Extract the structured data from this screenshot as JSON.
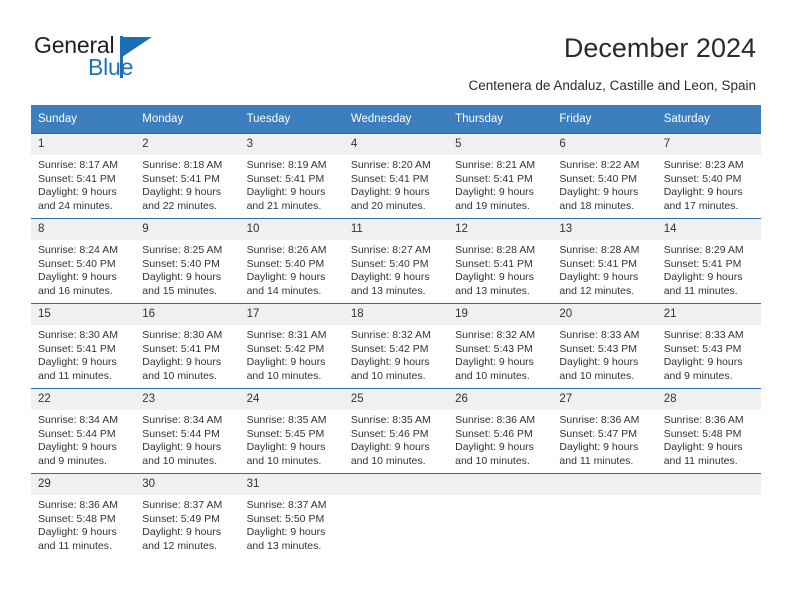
{
  "brand": {
    "name_top": "General",
    "name_bottom": "Blue",
    "accent_color": "#1c75bc"
  },
  "header": {
    "title": "December 2024",
    "subtitle": "Centenera de Andaluz, Castille and Leon, Spain",
    "header_bg_color": "#3d7ebf"
  },
  "calendar": {
    "weekday_headers": [
      "Sunday",
      "Monday",
      "Tuesday",
      "Wednesday",
      "Thursday",
      "Friday",
      "Saturday"
    ],
    "weeks": [
      [
        {
          "day": "1",
          "sunrise": "Sunrise: 8:17 AM",
          "sunset": "Sunset: 5:41 PM",
          "daylight1": "Daylight: 9 hours",
          "daylight2": "and 24 minutes."
        },
        {
          "day": "2",
          "sunrise": "Sunrise: 8:18 AM",
          "sunset": "Sunset: 5:41 PM",
          "daylight1": "Daylight: 9 hours",
          "daylight2": "and 22 minutes."
        },
        {
          "day": "3",
          "sunrise": "Sunrise: 8:19 AM",
          "sunset": "Sunset: 5:41 PM",
          "daylight1": "Daylight: 9 hours",
          "daylight2": "and 21 minutes."
        },
        {
          "day": "4",
          "sunrise": "Sunrise: 8:20 AM",
          "sunset": "Sunset: 5:41 PM",
          "daylight1": "Daylight: 9 hours",
          "daylight2": "and 20 minutes."
        },
        {
          "day": "5",
          "sunrise": "Sunrise: 8:21 AM",
          "sunset": "Sunset: 5:41 PM",
          "daylight1": "Daylight: 9 hours",
          "daylight2": "and 19 minutes."
        },
        {
          "day": "6",
          "sunrise": "Sunrise: 8:22 AM",
          "sunset": "Sunset: 5:40 PM",
          "daylight1": "Daylight: 9 hours",
          "daylight2": "and 18 minutes."
        },
        {
          "day": "7",
          "sunrise": "Sunrise: 8:23 AM",
          "sunset": "Sunset: 5:40 PM",
          "daylight1": "Daylight: 9 hours",
          "daylight2": "and 17 minutes."
        }
      ],
      [
        {
          "day": "8",
          "sunrise": "Sunrise: 8:24 AM",
          "sunset": "Sunset: 5:40 PM",
          "daylight1": "Daylight: 9 hours",
          "daylight2": "and 16 minutes."
        },
        {
          "day": "9",
          "sunrise": "Sunrise: 8:25 AM",
          "sunset": "Sunset: 5:40 PM",
          "daylight1": "Daylight: 9 hours",
          "daylight2": "and 15 minutes."
        },
        {
          "day": "10",
          "sunrise": "Sunrise: 8:26 AM",
          "sunset": "Sunset: 5:40 PM",
          "daylight1": "Daylight: 9 hours",
          "daylight2": "and 14 minutes."
        },
        {
          "day": "11",
          "sunrise": "Sunrise: 8:27 AM",
          "sunset": "Sunset: 5:40 PM",
          "daylight1": "Daylight: 9 hours",
          "daylight2": "and 13 minutes."
        },
        {
          "day": "12",
          "sunrise": "Sunrise: 8:28 AM",
          "sunset": "Sunset: 5:41 PM",
          "daylight1": "Daylight: 9 hours",
          "daylight2": "and 13 minutes."
        },
        {
          "day": "13",
          "sunrise": "Sunrise: 8:28 AM",
          "sunset": "Sunset: 5:41 PM",
          "daylight1": "Daylight: 9 hours",
          "daylight2": "and 12 minutes."
        },
        {
          "day": "14",
          "sunrise": "Sunrise: 8:29 AM",
          "sunset": "Sunset: 5:41 PM",
          "daylight1": "Daylight: 9 hours",
          "daylight2": "and 11 minutes."
        }
      ],
      [
        {
          "day": "15",
          "sunrise": "Sunrise: 8:30 AM",
          "sunset": "Sunset: 5:41 PM",
          "daylight1": "Daylight: 9 hours",
          "daylight2": "and 11 minutes."
        },
        {
          "day": "16",
          "sunrise": "Sunrise: 8:30 AM",
          "sunset": "Sunset: 5:41 PM",
          "daylight1": "Daylight: 9 hours",
          "daylight2": "and 10 minutes."
        },
        {
          "day": "17",
          "sunrise": "Sunrise: 8:31 AM",
          "sunset": "Sunset: 5:42 PM",
          "daylight1": "Daylight: 9 hours",
          "daylight2": "and 10 minutes."
        },
        {
          "day": "18",
          "sunrise": "Sunrise: 8:32 AM",
          "sunset": "Sunset: 5:42 PM",
          "daylight1": "Daylight: 9 hours",
          "daylight2": "and 10 minutes."
        },
        {
          "day": "19",
          "sunrise": "Sunrise: 8:32 AM",
          "sunset": "Sunset: 5:43 PM",
          "daylight1": "Daylight: 9 hours",
          "daylight2": "and 10 minutes."
        },
        {
          "day": "20",
          "sunrise": "Sunrise: 8:33 AM",
          "sunset": "Sunset: 5:43 PM",
          "daylight1": "Daylight: 9 hours",
          "daylight2": "and 10 minutes."
        },
        {
          "day": "21",
          "sunrise": "Sunrise: 8:33 AM",
          "sunset": "Sunset: 5:43 PM",
          "daylight1": "Daylight: 9 hours",
          "daylight2": "and 9 minutes."
        }
      ],
      [
        {
          "day": "22",
          "sunrise": "Sunrise: 8:34 AM",
          "sunset": "Sunset: 5:44 PM",
          "daylight1": "Daylight: 9 hours",
          "daylight2": "and 9 minutes."
        },
        {
          "day": "23",
          "sunrise": "Sunrise: 8:34 AM",
          "sunset": "Sunset: 5:44 PM",
          "daylight1": "Daylight: 9 hours",
          "daylight2": "and 10 minutes."
        },
        {
          "day": "24",
          "sunrise": "Sunrise: 8:35 AM",
          "sunset": "Sunset: 5:45 PM",
          "daylight1": "Daylight: 9 hours",
          "daylight2": "and 10 minutes."
        },
        {
          "day": "25",
          "sunrise": "Sunrise: 8:35 AM",
          "sunset": "Sunset: 5:46 PM",
          "daylight1": "Daylight: 9 hours",
          "daylight2": "and 10 minutes."
        },
        {
          "day": "26",
          "sunrise": "Sunrise: 8:36 AM",
          "sunset": "Sunset: 5:46 PM",
          "daylight1": "Daylight: 9 hours",
          "daylight2": "and 10 minutes."
        },
        {
          "day": "27",
          "sunrise": "Sunrise: 8:36 AM",
          "sunset": "Sunset: 5:47 PM",
          "daylight1": "Daylight: 9 hours",
          "daylight2": "and 11 minutes."
        },
        {
          "day": "28",
          "sunrise": "Sunrise: 8:36 AM",
          "sunset": "Sunset: 5:48 PM",
          "daylight1": "Daylight: 9 hours",
          "daylight2": "and 11 minutes."
        }
      ],
      [
        {
          "day": "29",
          "sunrise": "Sunrise: 8:36 AM",
          "sunset": "Sunset: 5:48 PM",
          "daylight1": "Daylight: 9 hours",
          "daylight2": "and 11 minutes."
        },
        {
          "day": "30",
          "sunrise": "Sunrise: 8:37 AM",
          "sunset": "Sunset: 5:49 PM",
          "daylight1": "Daylight: 9 hours",
          "daylight2": "and 12 minutes."
        },
        {
          "day": "31",
          "sunrise": "Sunrise: 8:37 AM",
          "sunset": "Sunset: 5:50 PM",
          "daylight1": "Daylight: 9 hours",
          "daylight2": "and 13 minutes."
        },
        {
          "day": "",
          "sunrise": "",
          "sunset": "",
          "daylight1": "",
          "daylight2": ""
        },
        {
          "day": "",
          "sunrise": "",
          "sunset": "",
          "daylight1": "",
          "daylight2": ""
        },
        {
          "day": "",
          "sunrise": "",
          "sunset": "",
          "daylight1": "",
          "daylight2": ""
        },
        {
          "day": "",
          "sunrise": "",
          "sunset": "",
          "daylight1": "",
          "daylight2": ""
        }
      ]
    ]
  }
}
